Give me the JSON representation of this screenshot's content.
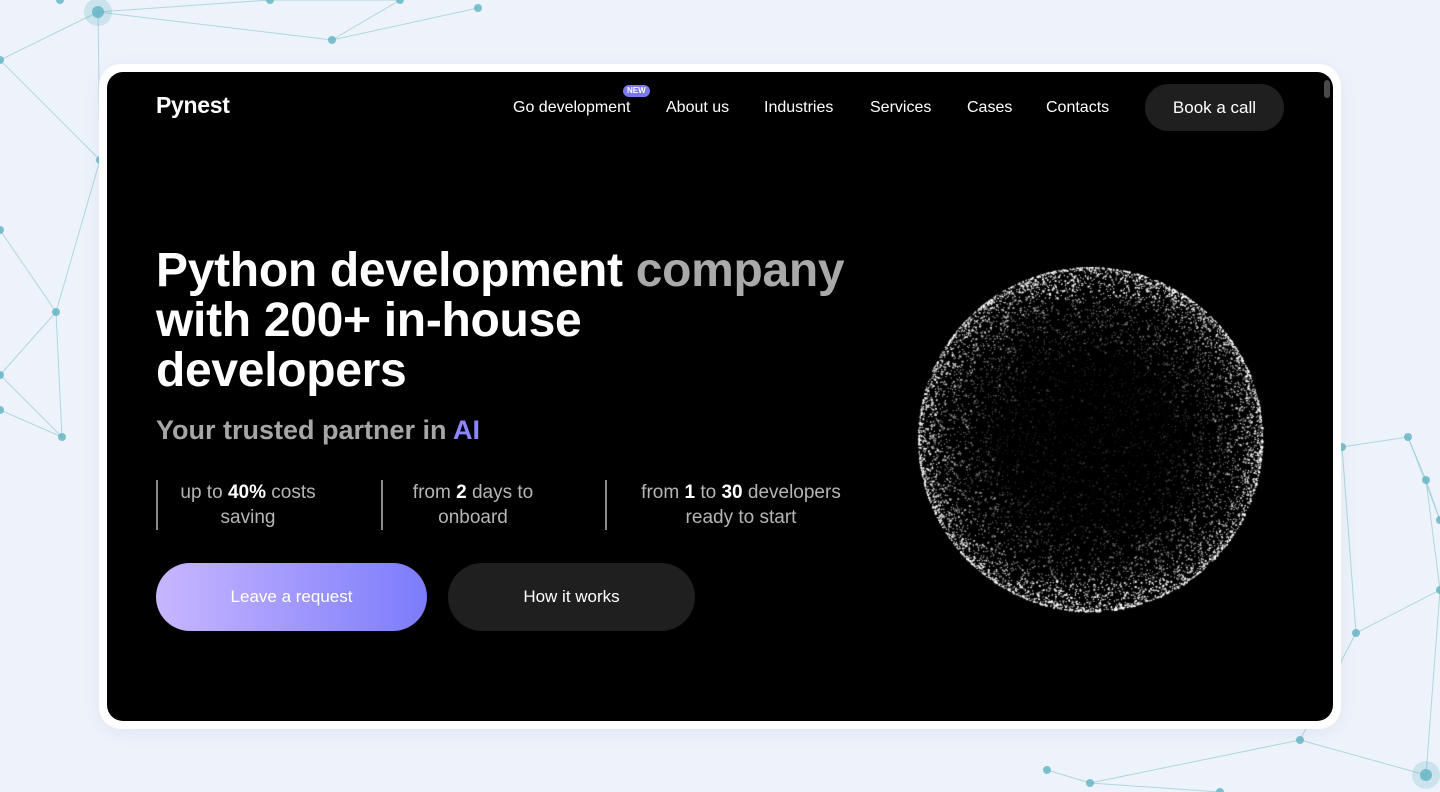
{
  "header": {
    "logo": "Pynest",
    "nav": [
      {
        "label": "Go development",
        "badge": "NEW"
      },
      {
        "label": "About us"
      },
      {
        "label": "Industries"
      },
      {
        "label": "Services"
      },
      {
        "label": "Cases"
      },
      {
        "label": "Contacts"
      }
    ],
    "cta_label": "Book a call"
  },
  "hero": {
    "title_part1": "Python development",
    "title_part2": "company",
    "title_line2": "with 200+ in-house",
    "title_line3": "developers",
    "subtitle_prefix": "Your trusted partner in",
    "subtitle_accent": "AI",
    "stats": [
      {
        "pre": "up to",
        "value": "40%",
        "post": "costs",
        "line2": "saving"
      },
      {
        "pre": "from",
        "value": "2",
        "post": "days to",
        "line2": "onboard"
      },
      {
        "pre": "from",
        "value": "1",
        "mid": "to",
        "value2": "30",
        "post": "developers",
        "line2": "ready to start"
      }
    ],
    "primary_button": "Leave a request",
    "secondary_button": "How it works"
  },
  "colors": {
    "page_background": "#eef3fb",
    "screen_background": "#000000",
    "accent": "#8d87ff",
    "button_gradient_start": "#c8b6ff",
    "button_gradient_end": "#7c7cfb",
    "network_lines": "#9fcfd8",
    "network_nodes": "#5fb3c2"
  }
}
